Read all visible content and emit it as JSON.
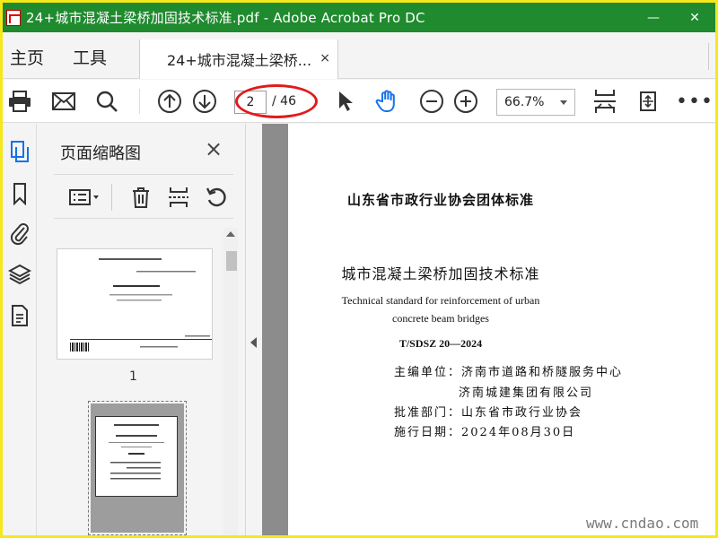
{
  "window": {
    "title": "24+城市混凝土梁桥加固技术标准.pdf - Adobe Acrobat Pro DC",
    "minimize": "—",
    "close": "✕"
  },
  "menu": {
    "home": "主页",
    "tools": "工具",
    "doc_tab": "24+城市混凝土梁桥...",
    "doc_tab_close": "×"
  },
  "toolbar": {
    "current_page": "2",
    "total_pages": "/ 46",
    "zoom": "66.7%",
    "more": "•••",
    "highlight_color": "#e01b1b"
  },
  "panel": {
    "title": "页面缩略图",
    "close": "×",
    "thumbnails": [
      {
        "label": "1"
      }
    ]
  },
  "page": {
    "org_title": "山东省市政行业协会团体标准",
    "doc_title": "城市混凝土梁桥加固技术标准",
    "english_line1": "Technical standard for reinforcement of urban",
    "english_line2": "concrete beam bridges",
    "code": "T/SDSZ 20—2024",
    "lines": [
      "主编单位：济南市道路和桥隧服务中心",
      "济南城建集团有限公司",
      "批准部门：山东省市政行业协会",
      "施行日期：2024年08月30日"
    ]
  },
  "watermark": "www.cndao.com",
  "colors": {
    "titlebar": "#1f8a2e",
    "outer_frame": "#f5e81b",
    "accent_blue": "#1473e6"
  }
}
